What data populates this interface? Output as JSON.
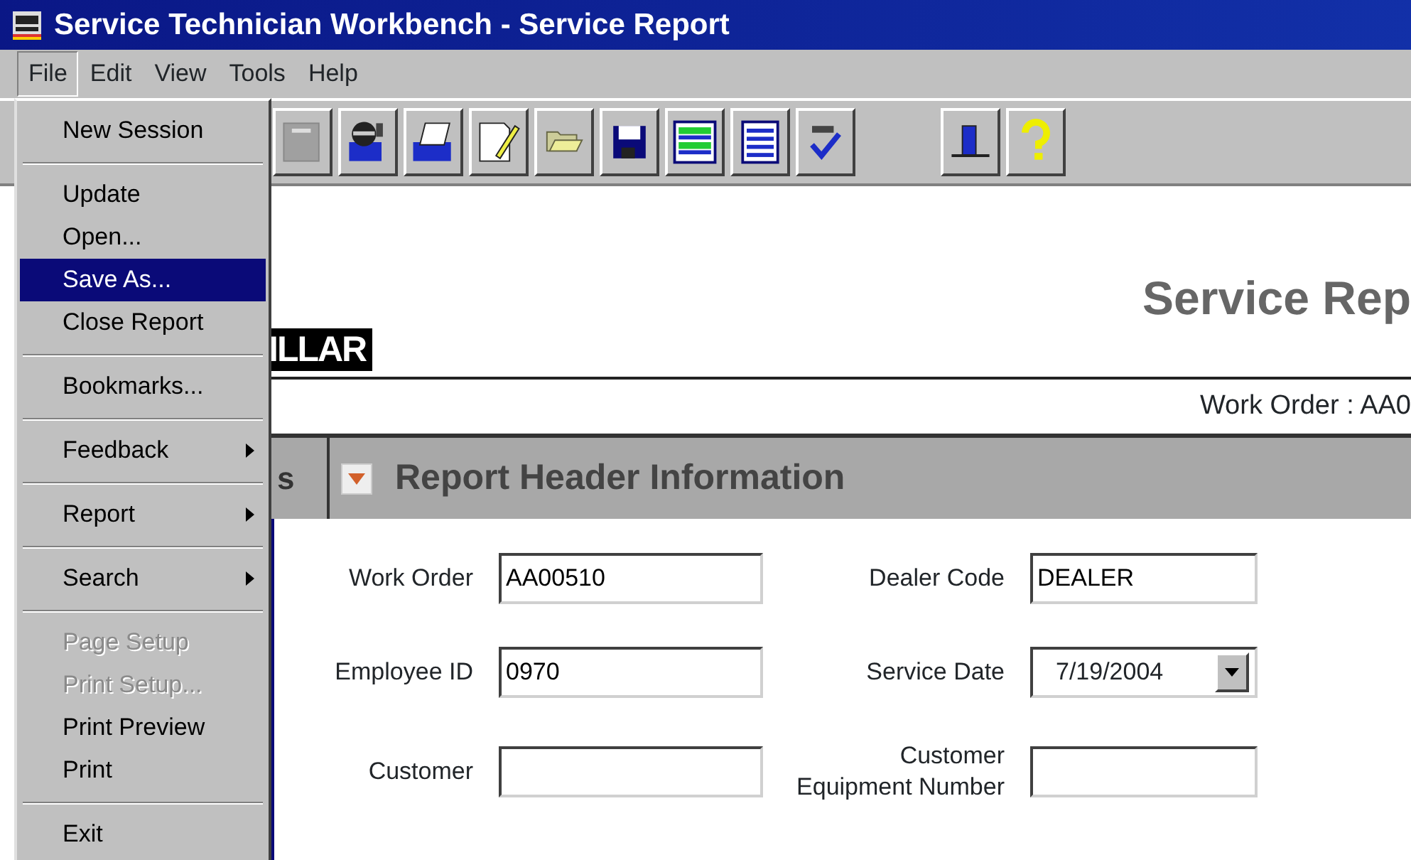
{
  "window": {
    "title": "Service Technician Workbench - Service Report"
  },
  "menu_bar": [
    {
      "label": "File",
      "selected": true
    },
    {
      "label": "Edit",
      "selected": false
    },
    {
      "label": "View",
      "selected": false
    },
    {
      "label": "Tools",
      "selected": false
    },
    {
      "label": "Help",
      "selected": false
    }
  ],
  "file_menu": [
    {
      "kind": "item",
      "label": "New Session",
      "selected": false,
      "disabled": false,
      "submenu": false
    },
    {
      "kind": "separator"
    },
    {
      "kind": "item",
      "label": "Update",
      "selected": false,
      "disabled": false,
      "submenu": false
    },
    {
      "kind": "item",
      "label": "Open...",
      "selected": false,
      "disabled": false,
      "submenu": false
    },
    {
      "kind": "item",
      "label": "Save As...",
      "selected": true,
      "disabled": false,
      "submenu": false
    },
    {
      "kind": "item",
      "label": "Close Report",
      "selected": false,
      "disabled": false,
      "submenu": false
    },
    {
      "kind": "separator"
    },
    {
      "kind": "item",
      "label": "Bookmarks...",
      "selected": false,
      "disabled": false,
      "submenu": false
    },
    {
      "kind": "separator"
    },
    {
      "kind": "item",
      "label": "Feedback",
      "selected": false,
      "disabled": false,
      "submenu": true
    },
    {
      "kind": "separator"
    },
    {
      "kind": "item",
      "label": "Report",
      "selected": false,
      "disabled": false,
      "submenu": true
    },
    {
      "kind": "separator"
    },
    {
      "kind": "item",
      "label": "Search",
      "selected": false,
      "disabled": false,
      "submenu": true
    },
    {
      "kind": "separator"
    },
    {
      "kind": "item",
      "label": "Page Setup",
      "selected": false,
      "disabled": true,
      "submenu": false
    },
    {
      "kind": "item",
      "label": "Print Setup...",
      "selected": false,
      "disabled": true,
      "submenu": false
    },
    {
      "kind": "item",
      "label": "Print Preview",
      "selected": false,
      "disabled": false,
      "submenu": false
    },
    {
      "kind": "item",
      "label": "Print",
      "selected": false,
      "disabled": false,
      "submenu": false
    },
    {
      "kind": "separator"
    },
    {
      "kind": "item",
      "label": "Exit",
      "selected": false,
      "disabled": false,
      "submenu": false
    }
  ],
  "report": {
    "logo": "ILLAR",
    "title": "Service Rep",
    "work_order_line": "Work Order : AA0",
    "side_tab": "s",
    "section": {
      "title": "Report Header Information",
      "expanded": true
    },
    "fields": [
      {
        "kind": "text",
        "label": "Work Order",
        "value": "AA00510"
      },
      {
        "kind": "text",
        "label": "Dealer Code",
        "value": "DEALER"
      },
      {
        "kind": "text",
        "label": "Employee ID",
        "value": "0970"
      },
      {
        "kind": "dropdown",
        "label": "Service Date",
        "value": "7/19/2004"
      },
      {
        "kind": "text",
        "label": "Customer"
      },
      {
        "kind": "text",
        "label": "Customer Equipment Number"
      }
    ]
  }
}
